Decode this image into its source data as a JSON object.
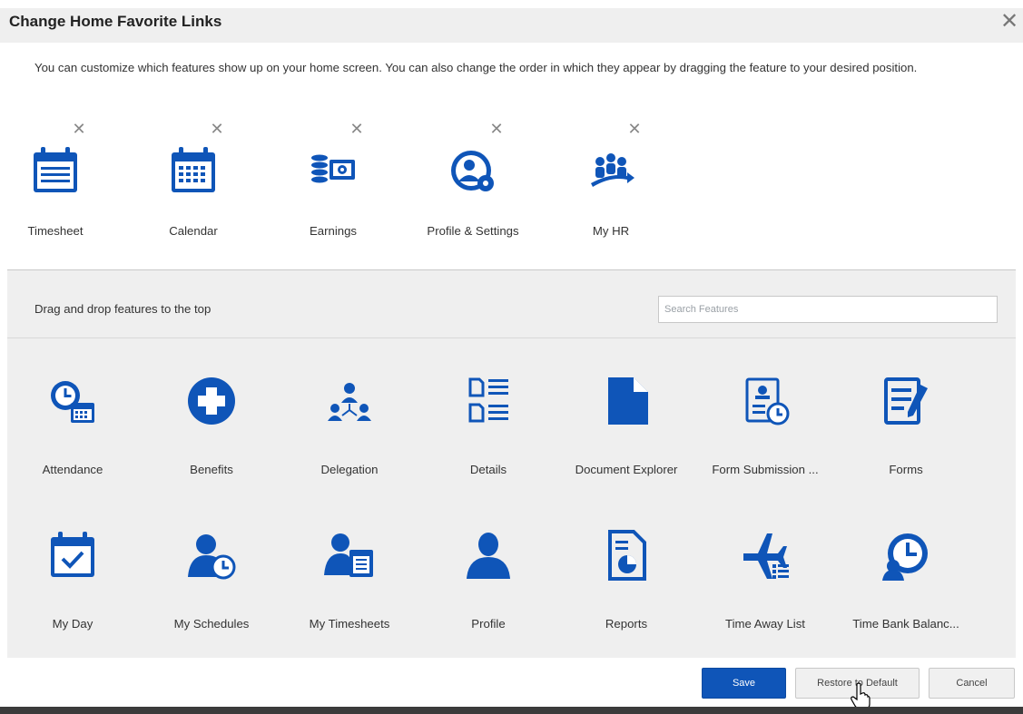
{
  "dialog": {
    "title": "Change Home Favorite Links",
    "description": "You can customize which features show up on your home screen. You can also change the order in which they appear by dragging the feature to your desired position.",
    "close_icon": "close-icon"
  },
  "favorites": [
    {
      "label": "Timesheet",
      "icon": "timesheet-icon"
    },
    {
      "label": "Calendar",
      "icon": "calendar-icon"
    },
    {
      "label": "Earnings",
      "icon": "earnings-icon"
    },
    {
      "label": "Profile & Settings",
      "icon": "profile-settings-icon"
    },
    {
      "label": "My HR",
      "icon": "my-hr-icon"
    }
  ],
  "available": {
    "hint": "Drag and drop features to the top",
    "search_placeholder": "Search Features",
    "features": [
      {
        "label": "Attendance",
        "icon": "attendance-icon"
      },
      {
        "label": "Benefits",
        "icon": "benefits-icon"
      },
      {
        "label": "Delegation",
        "icon": "delegation-icon"
      },
      {
        "label": "Details",
        "icon": "details-icon"
      },
      {
        "label": "Document Explorer",
        "icon": "document-explorer-icon"
      },
      {
        "label": "Form Submission ...",
        "icon": "form-submission-icon"
      },
      {
        "label": "Forms",
        "icon": "forms-icon"
      },
      {
        "label": "My Day",
        "icon": "my-day-icon"
      },
      {
        "label": "My Schedules",
        "icon": "my-schedules-icon"
      },
      {
        "label": "My Timesheets",
        "icon": "my-timesheets-icon"
      },
      {
        "label": "Profile",
        "icon": "profile-icon"
      },
      {
        "label": "Reports",
        "icon": "reports-icon"
      },
      {
        "label": "Time Away List",
        "icon": "time-away-list-icon"
      },
      {
        "label": "Time Bank Balanc...",
        "icon": "time-bank-balance-icon"
      }
    ]
  },
  "footer": {
    "save_label": "Save",
    "restore_label": "Restore to Default",
    "cancel_label": "Cancel"
  },
  "colors": {
    "icon_blue": "#0f55b8",
    "save_button": "#0f55b8",
    "panel_grey": "#efefef"
  }
}
